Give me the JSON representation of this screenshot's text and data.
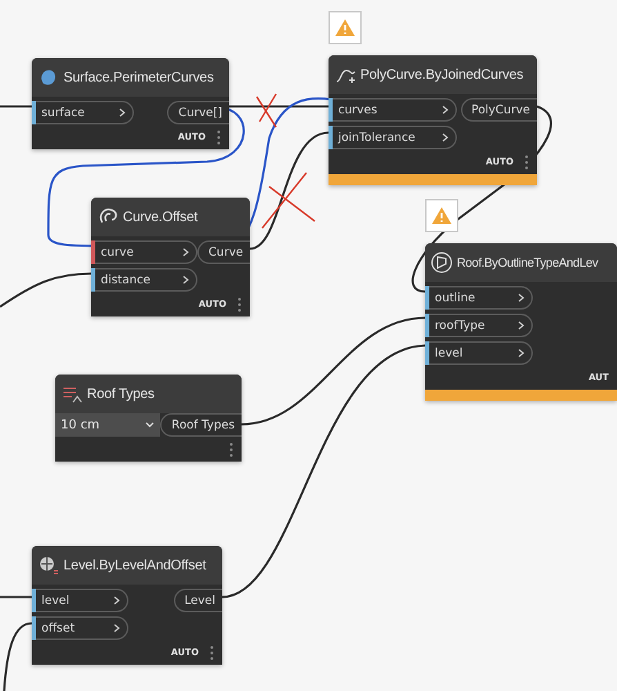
{
  "nodes": [
    {
      "kind": "function",
      "title": "Surface.PerimeterCurves",
      "warning": false,
      "inputs": [
        {
          "label": "surface",
          "color": "#6fb0d8"
        }
      ],
      "outputs": [
        "Curve[]"
      ],
      "lacing": "AUTO"
    },
    {
      "kind": "function",
      "title": "PolyCurve.ByJoinedCurves",
      "warning": true,
      "inputs": [
        {
          "label": "curves",
          "color": "#6fb0d8"
        },
        {
          "label": "joinTolerance",
          "color": "#6fb0d8"
        }
      ],
      "outputs": [
        "PolyCurve"
      ],
      "lacing": "AUTO"
    },
    {
      "kind": "function",
      "title": "Curve.Offset",
      "warning": false,
      "inputs": [
        {
          "label": "curve",
          "color": "#d0585a"
        },
        {
          "label": "distance",
          "color": "#6fb0d8"
        }
      ],
      "outputs": [
        "Curve"
      ],
      "lacing": "AUTO"
    },
    {
      "kind": "function",
      "title": "Roof.ByOutlineTypeAndLev",
      "warning": true,
      "inputs": [
        {
          "label": "outline",
          "color": "#6fb0d8"
        },
        {
          "label": "roofType",
          "color": "#6fb0d8"
        },
        {
          "label": "level",
          "color": "#6fb0d8"
        }
      ],
      "lacing": "AUT"
    },
    {
      "kind": "dropdown",
      "title": "Roof Types",
      "warning": false,
      "value": "10 cm",
      "outputs": [
        "Roof Types"
      ]
    },
    {
      "kind": "function",
      "title": "Level.ByLevelAndOffset",
      "warning": false,
      "inputs": [
        {
          "label": "level",
          "color": "#6fb0d8"
        },
        {
          "label": "offset",
          "color": "#6fb0d8"
        }
      ],
      "outputs": [
        "Level"
      ],
      "lacing": "AUTO"
    }
  ]
}
